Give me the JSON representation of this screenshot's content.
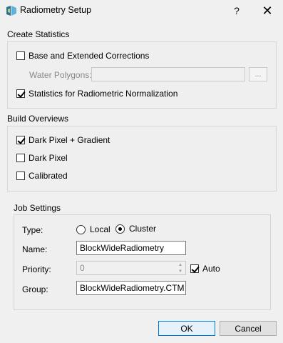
{
  "window": {
    "title": "Radiometry Setup",
    "help_glyph": "?",
    "close_glyph": "✕",
    "icon": "app-logo-icon"
  },
  "create_statistics": {
    "heading": "Create Statistics",
    "base_extended": {
      "label": "Base and Extended Corrections",
      "checked": false
    },
    "water_polygons": {
      "label": "Water Polygons:",
      "value": "",
      "browse_label": "...",
      "enabled": false
    },
    "stats_normalization": {
      "label": "Statistics for Radiometric Normalization",
      "checked": true
    }
  },
  "build_overviews": {
    "heading": "Build Overviews",
    "options": [
      {
        "label": "Dark Pixel + Gradient",
        "checked": true
      },
      {
        "label": "Dark Pixel",
        "checked": false
      },
      {
        "label": "Calibrated",
        "checked": false
      }
    ]
  },
  "job_settings": {
    "heading": "Job Settings",
    "type": {
      "label": "Type:",
      "options": [
        "Local",
        "Cluster"
      ],
      "selected": "Cluster"
    },
    "name": {
      "label": "Name:",
      "value": "BlockWideRadiometry"
    },
    "priority": {
      "label": "Priority:",
      "value": "0",
      "enabled": false
    },
    "auto": {
      "label": "Auto",
      "checked": true
    },
    "group": {
      "label": "Group:",
      "value": "BlockWideRadiometry.CTM"
    }
  },
  "buttons": {
    "ok": "OK",
    "cancel": "Cancel"
  },
  "colors": {
    "accent": "#0078d7",
    "background": "#f0f0f0",
    "disabled_text": "#8a8a8a"
  }
}
